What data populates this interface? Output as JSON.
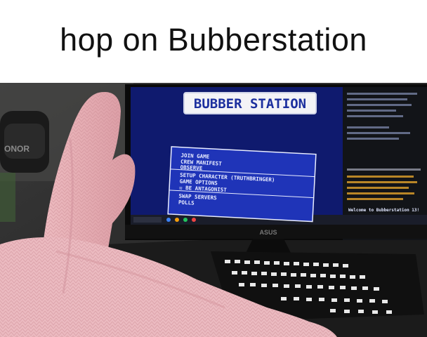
{
  "caption": "hop on Bubberstation",
  "screen": {
    "logo_text": "BUBBER STATION",
    "menu_items": [
      "JOIN GAME",
      "CREW MANIFEST",
      "OBSERVE",
      "SETUP CHARACTER (TRUTHBRINGER)",
      "GAME OPTIONS",
      "☒ BE ANTAGONIST",
      "SWAP SERVERS",
      "POLLS"
    ],
    "chat_banner": "Welcome to Bubberstation 13!"
  },
  "monitor_brand": "ASUS",
  "headset_brand": "ONOR",
  "colors": {
    "screen_bg": "#0f1a6e",
    "menu_panel": "#1f34b8",
    "logo_text": "#1c2f9e",
    "sock": "#e9b7bd"
  }
}
